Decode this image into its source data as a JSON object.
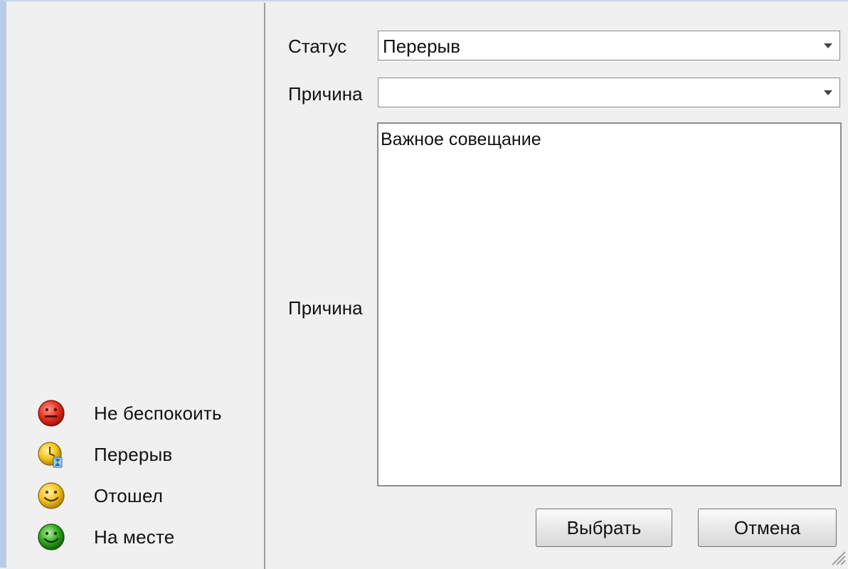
{
  "form": {
    "status_label": "Статус",
    "status_value": "Перерыв",
    "reason_label": "Причина",
    "reason_value": "",
    "reason_text_label": "Причина",
    "reason_text_value": "Важное совещание",
    "select_button": "Выбрать",
    "cancel_button": "Отмена"
  },
  "legend": [
    {
      "label": "Не беспокоить",
      "icon": "do-not-disturb-smiley-icon",
      "color": "#e02b1a"
    },
    {
      "label": "Перерыв",
      "icon": "break-clock-hourglass-icon",
      "color": "#f2c21b"
    },
    {
      "label": "Отошел",
      "icon": "away-smiley-icon",
      "color": "#f2c21b"
    },
    {
      "label": "На месте",
      "icon": "available-smiley-icon",
      "color": "#2fa41d"
    }
  ]
}
